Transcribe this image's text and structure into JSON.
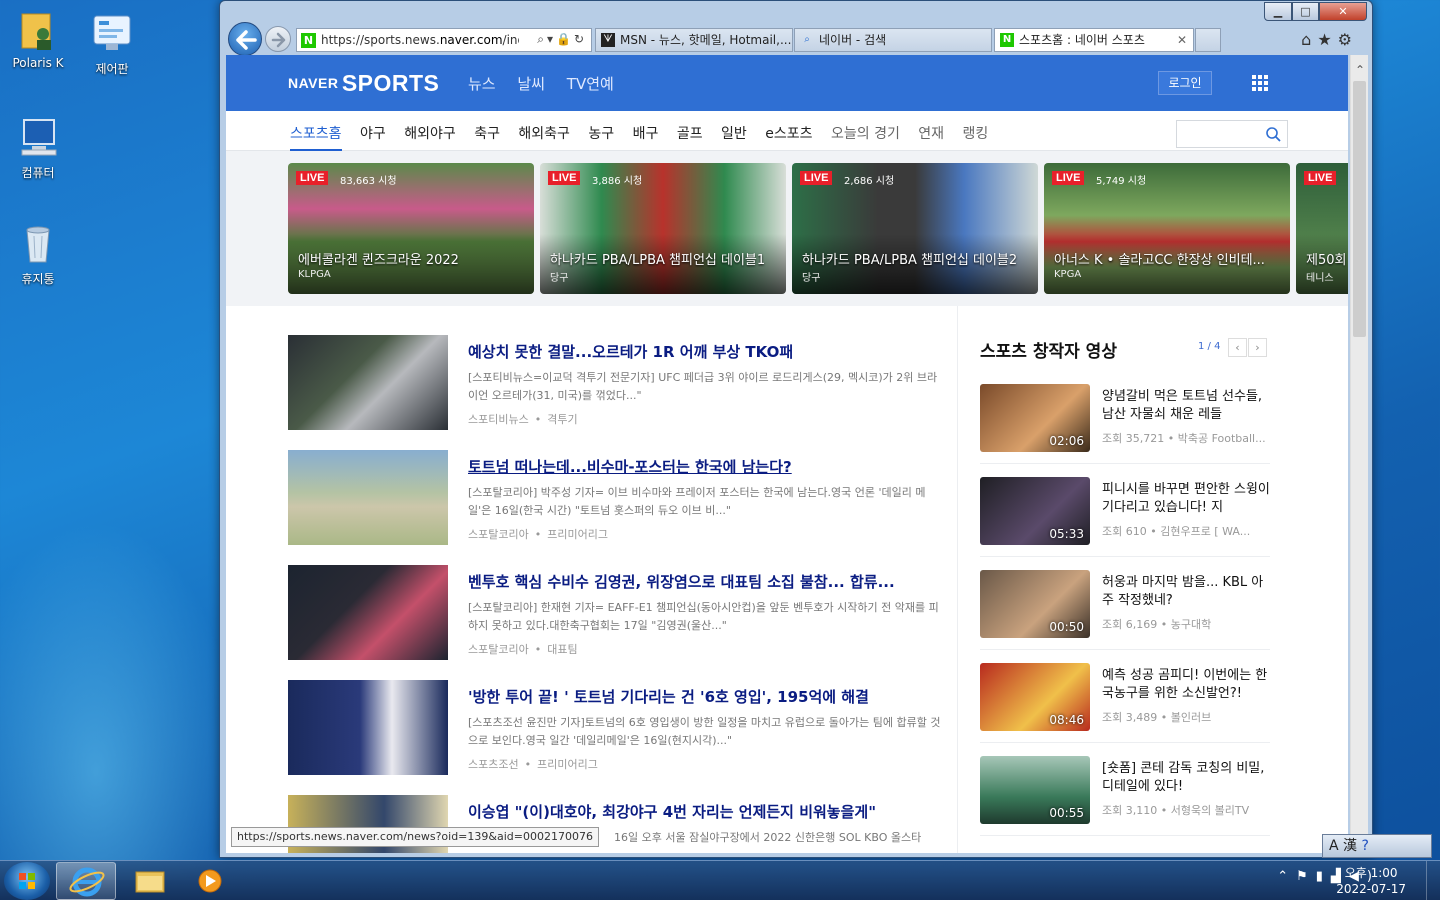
{
  "desktop": {
    "icons": [
      {
        "label": "Polaris K"
      },
      {
        "label": "제어판"
      },
      {
        "label": "컴퓨터"
      },
      {
        "label": "휴지통"
      }
    ]
  },
  "browser": {
    "url_prefix": "https://sports.news.",
    "url_domain": "naver.com",
    "url_suffix": "/index",
    "tabs": [
      {
        "label": "MSN - 뉴스, 핫메일, Hotmail,..."
      },
      {
        "label": "네이버 - 검색"
      },
      {
        "label": "스포츠홈 : 네이버 스포츠"
      }
    ],
    "status_url": "https://sports.news.naver.com/news?oid=139&aid=0002170076"
  },
  "header": {
    "logo_naver": "NAVER",
    "logo_sports": "SPORTS",
    "nav": [
      "뉴스",
      "날씨",
      "TV연예"
    ],
    "login": "로그인"
  },
  "subnav": {
    "items": [
      "스포츠홈",
      "야구",
      "해외야구",
      "축구",
      "해외축구",
      "농구",
      "배구",
      "골프",
      "일반",
      "e스포츠"
    ],
    "secondary": [
      "오늘의 경기",
      "연재",
      "랭킹"
    ]
  },
  "live": {
    "badge": "LIVE",
    "cards": [
      {
        "views": "83,663 시청",
        "title": "에버콜라겐 퀸즈크라운 2022",
        "sub": "KLPGA",
        "color1": "#3f6b3a",
        "color2": "#7aa45a"
      },
      {
        "views": "3,886 시청",
        "title": "하나카드 PBA/LPBA 챔피언십 데이블1",
        "sub": "당구",
        "color1": "#2f8a4f",
        "color2": "#c9d6cc"
      },
      {
        "views": "2,686 시청",
        "title": "하나카드 PBA/LPBA 챔피언십 데이블2",
        "sub": "당구",
        "color1": "#2d6f47",
        "color2": "#c7d3d8"
      },
      {
        "views": "5,749 시청",
        "title": "아너스 K • 솔라고CC 한장상 인비테...",
        "sub": "KPGA",
        "color1": "#3d7a3e",
        "color2": "#86b56a"
      },
      {
        "views": "",
        "title": "제50회",
        "sub": "테니스",
        "color1": "#2e5e3a",
        "color2": "#6a9a58"
      }
    ]
  },
  "news": [
    {
      "headline": "예상치 못한 결말...오르테가 1R 어깨 부상 TKO패",
      "desc": "[스포티비뉴스=이교덕 격투기 전문기자] UFC 페더급 3위 야이르 로드리게스(29, 멕시코)가 2위 브라이언 오르테가(31, 미국)를 꺾었다...\"",
      "source": "스포티비뉴스",
      "category": "격투기",
      "underline": false,
      "thumb1": "#2a2f35",
      "thumb2": "#6b7d6a"
    },
    {
      "headline": "토트넘 떠나는데...비수마-포스터는 한국에 남는다?",
      "desc": "[스포탈코리아] 박주성 기자= 이브 비수마와 프레이저 포스터는 한국에 남는다.영국 언론 '데일리 메일'은 16일(한국 시간) \"토트넘 홋스퍼의 듀오 이브 비...\"",
      "source": "스포탈코리아",
      "category": "프리미어리그",
      "underline": true,
      "thumb1": "#7aa6c8",
      "thumb2": "#b7c88e"
    },
    {
      "headline": "벤투호 핵심 수비수 김영권, 위장염으로 대표팀 소집 불참... 합류...",
      "desc": "[스포탈코리아] 한재현 기자= EAFF-E1 챔피언십(동아시안컵)을 앞둔 벤투호가 시작하기 전 악재를 피하지 못하고 있다.대한축구협회는 17일 \"김영권(울산...\"",
      "source": "스포탈코리아",
      "category": "대표팀",
      "underline": false,
      "thumb1": "#1c2430",
      "thumb2": "#c4506a"
    },
    {
      "headline": "'방한 투어 끝! ' 토트넘 기다리는 건 '6호 영입', 195억에 해결",
      "desc": "[스포츠조선 윤진만 기자]토트넘의 6호 영입생이 방한 일정을 마치고 유럽으로 돌아가는 팀에 합류할 것으로 보인다.영국 일간 '데일리메일'은 16일(현지시각)...\"",
      "source": "스포츠조선",
      "category": "프리미어리그",
      "underline": false,
      "thumb1": "#1a2a5c",
      "thumb2": "#e9e9ef"
    },
    {
      "headline": "이승엽 \"(이)대호야, 최강야구 4번 자리는 언제든지 비워놓을게\"",
      "desc": "16일 오후 서울 잠실야구장에서 2022 신한은행 SOL KBO 올스타",
      "source": "",
      "category": "",
      "underline": false,
      "thumb1": "#c7b15a",
      "thumb2": "#33476b"
    }
  ],
  "sidebar": {
    "title": "스포츠 창작자 영상",
    "page": "1 / 4",
    "videos": [
      {
        "title": "양념갈비 먹은 토트넘 선수들, 남산 자물쇠 채운 레들",
        "meta": "조회 35,721 • 박축공 Football...",
        "duration": "02:06",
        "c1": "#7a4a2a",
        "c2": "#d9a06a"
      },
      {
        "title": "피니시를 바꾸면 편안한 스윙이 기다리고 있습니다! 지",
        "meta": "조회 610 • 김현우프로 [ WA...",
        "duration": "05:33",
        "c1": "#1f1f24",
        "c2": "#5a4a6a"
      },
      {
        "title": "허웅과 마지막 밤을... KBL 아주 작정했네?",
        "meta": "조회 6,169 • 농구대학",
        "duration": "00:50",
        "c1": "#6a5848",
        "c2": "#c9a27e"
      },
      {
        "title": "예측 성공 곰피디! 이번에는 한국농구를 위한 소신발언?!",
        "meta": "조회 3,489 • 볼인러브",
        "duration": "08:46",
        "c1": "#b82a1e",
        "c2": "#f0c04a"
      },
      {
        "title": "[숏폼] 콘테 감독 코칭의 비밀, 디테일에 있다!",
        "meta": "조회 3,110 • 서형욱의 볼리TV",
        "duration": "00:55",
        "c1": "#3a7a5a",
        "c2": "#a7c7b8"
      }
    ]
  },
  "taskbar": {
    "clock_time": "오후 1:00",
    "clock_date": "2022-07-17",
    "ime": "A 漢"
  }
}
